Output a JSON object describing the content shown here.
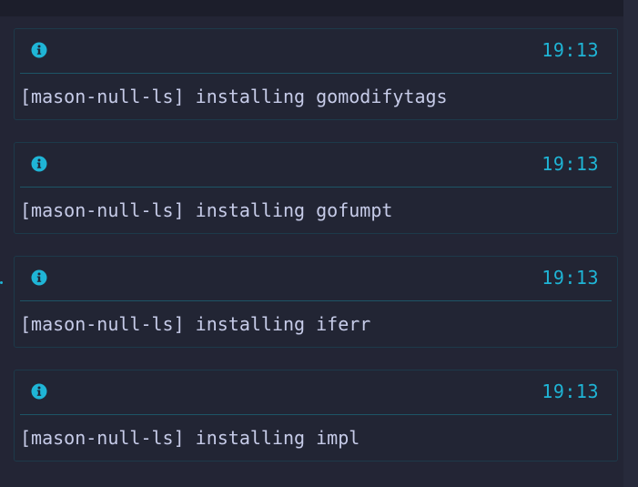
{
  "notifications": [
    {
      "level": "info",
      "icon": "info-circle-icon",
      "time": "19:13",
      "message": "[mason-null-ls] installing gomodifytags"
    },
    {
      "level": "info",
      "icon": "info-circle-icon",
      "time": "19:13",
      "message": "[mason-null-ls] installing gofumpt"
    },
    {
      "level": "info",
      "icon": "info-circle-icon",
      "time": "19:13",
      "message": "[mason-null-ls] installing iferr"
    },
    {
      "level": "info",
      "icon": "info-circle-icon",
      "time": "19:13",
      "message": "[mason-null-ls] installing impl"
    }
  ],
  "colors": {
    "background": "#232535",
    "border": "#1d3a4a",
    "accent": "#1fb5d6",
    "text": "#c6cbe8"
  }
}
